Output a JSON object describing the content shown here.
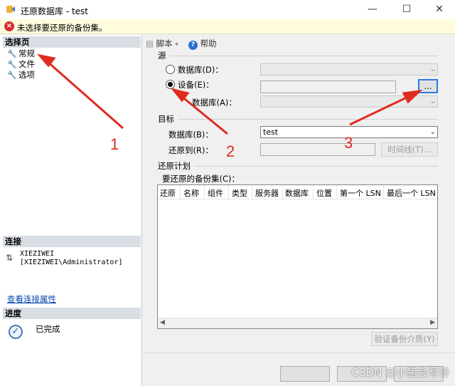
{
  "window": {
    "title": "还原数据库 - test",
    "min": "—",
    "max": "☐",
    "close": "✕"
  },
  "error": {
    "icon": "error-icon",
    "message": "未选择要还原的备份集。"
  },
  "left": {
    "pages_header": "选择页",
    "pages": [
      {
        "label": "常规"
      },
      {
        "label": "文件"
      },
      {
        "label": "选项"
      }
    ],
    "connection_header": "连接",
    "server": "XIEZIWEI",
    "user": "[XIEZIWEI\\Administrator]",
    "view_link": "查看连接属性",
    "progress_header": "进度",
    "progress_status": "已完成"
  },
  "toolbar": {
    "script": "脚本",
    "help": "帮助"
  },
  "source": {
    "group": "源",
    "database_option": "数据库(D)：",
    "device_option": "设备(E)：",
    "browse_button": "...",
    "database_label": "数据库(A)："
  },
  "target": {
    "group": "目标",
    "database_label": "数据库(B)：",
    "database_value": "test",
    "restore_to_label": "还原到(R)：",
    "timeline_button": "时间线(T)..."
  },
  "plan": {
    "group": "还原计划",
    "backup_sets_label": "要还原的备份集(C)：",
    "columns": [
      "还原",
      "名称",
      "组件",
      "类型",
      "服务器",
      "数据库",
      "位置",
      "第一个 LSN",
      "最后一个 LSN"
    ],
    "verify_button": "验证备份介质(Y)"
  },
  "annotations": {
    "n1": "1",
    "n2": "2",
    "n3": "3",
    "color": "#e02b20"
  },
  "watermark": "CSDN @小猪会写诗"
}
